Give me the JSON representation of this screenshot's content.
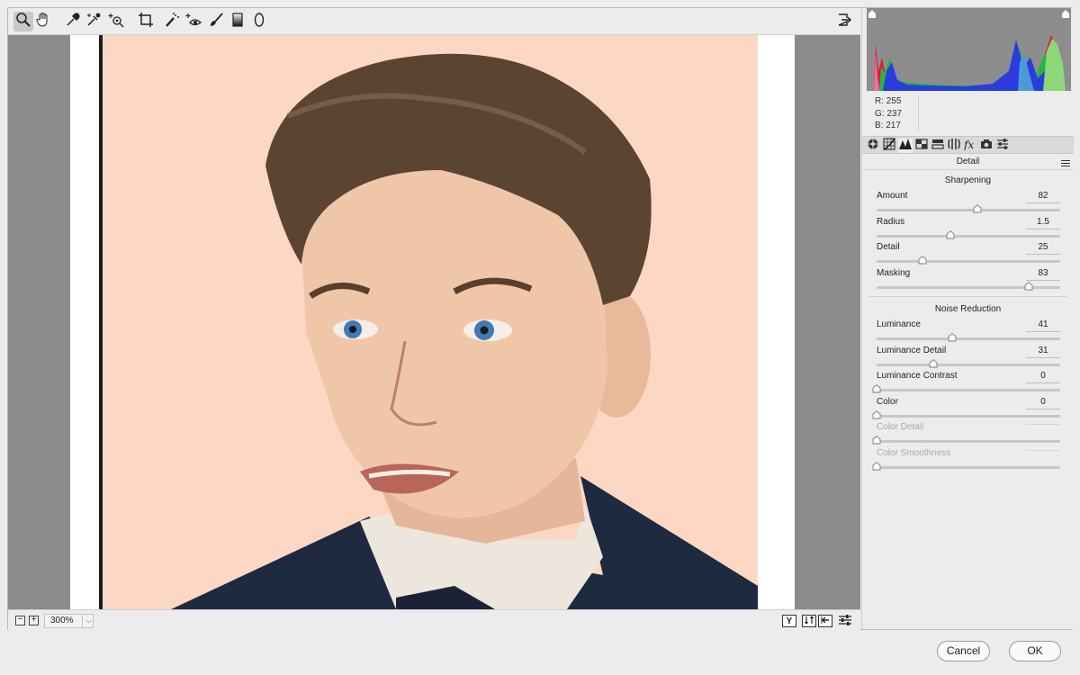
{
  "toolbar": {
    "tools": [
      {
        "name": "zoom-tool",
        "icon": "magnifier-icon",
        "active": true
      },
      {
        "name": "hand-tool",
        "icon": "hand-icon"
      },
      {
        "name": "white-balance-tool",
        "icon": "eyedropper-icon"
      },
      {
        "name": "color-sampler-tool",
        "icon": "eyedropper-sparkle-icon"
      },
      {
        "name": "targeted-adjustment-tool",
        "icon": "target-icon"
      },
      {
        "name": "transform-tool",
        "icon": "crop-frame-icon"
      },
      {
        "name": "spot-removal-tool",
        "icon": "brush-dots-icon"
      },
      {
        "name": "red-eye-tool",
        "icon": "eye-plus-icon"
      },
      {
        "name": "adjustment-brush-tool",
        "icon": "brush-icon"
      },
      {
        "name": "graduated-filter-tool",
        "icon": "gradient-icon"
      },
      {
        "name": "radial-filter-tool",
        "icon": "ellipse-icon"
      }
    ],
    "export_icon": "export-icon"
  },
  "status": {
    "zoom_value": "300%",
    "zoom_out": "−",
    "zoom_in": "+",
    "view_y_label": "Y"
  },
  "panel": {
    "rgb": {
      "r": "R:  255",
      "g": "G:  237",
      "b": "B:  217"
    },
    "tabs": [
      "basic-icon",
      "tone-curve-icon",
      "detail-icon",
      "hsl-icon",
      "split-toning-icon",
      "lens-corrections-icon",
      "fx-icon",
      "camera-calibration-icon",
      "presets-icon"
    ],
    "title": "Detail",
    "sharpening": {
      "title": "Sharpening",
      "sliders": [
        {
          "label": "Amount",
          "value": "82",
          "fraction": 0.547
        },
        {
          "label": "Radius",
          "value": "1.5",
          "fraction": 0.4
        },
        {
          "label": "Detail",
          "value": "25",
          "fraction": 0.25
        },
        {
          "label": "Masking",
          "value": "83",
          "fraction": 0.83
        }
      ]
    },
    "noise_reduction": {
      "title": "Noise Reduction",
      "sliders": [
        {
          "label": "Luminance",
          "value": "41",
          "fraction": 0.41
        },
        {
          "label": "Luminance Detail",
          "value": "31",
          "fraction": 0.31
        },
        {
          "label": "Luminance Contrast",
          "value": "0",
          "fraction": 0
        },
        {
          "label": "Color",
          "value": "0",
          "fraction": 0
        },
        {
          "label": "Color Detail",
          "value": "",
          "fraction": 0,
          "disabled": true
        },
        {
          "label": "Color Smoothness",
          "value": "",
          "fraction": 0,
          "disabled": true
        }
      ]
    }
  },
  "footer": {
    "cancel": "Cancel",
    "ok": "OK"
  },
  "colors": {
    "background": "#ececec",
    "canvas": "#8b8b8b",
    "skin": "#f0c6a9",
    "backdrop": "#fcd8c4",
    "hair": "#5c4433",
    "jacket": "#1d2a3f",
    "eyes": "#3f7bb5"
  }
}
